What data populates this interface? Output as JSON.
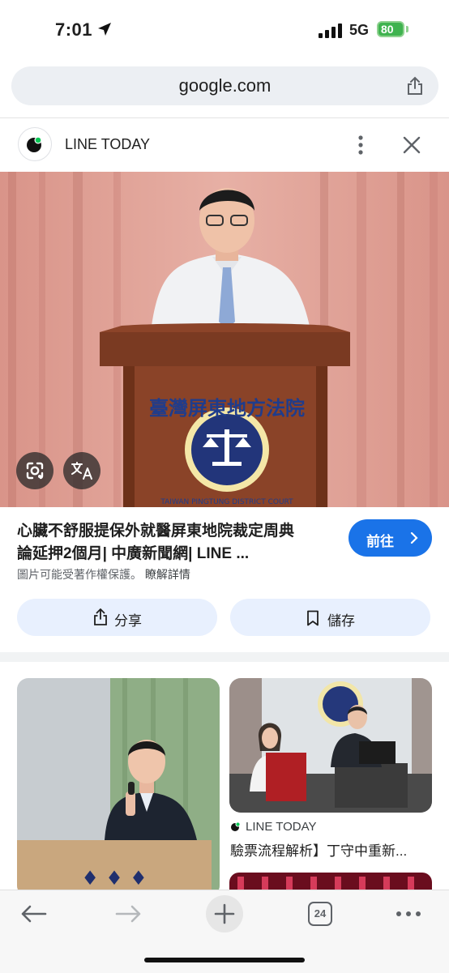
{
  "status_bar": {
    "time": "7:01",
    "network": "5G",
    "battery": "80"
  },
  "browser": {
    "url": "google.com"
  },
  "source": {
    "name": "LINE TODAY"
  },
  "result": {
    "title_line1": "心臟不舒服提保外就醫屏東地院裁定周典",
    "title_line2": "論延押2個月| 中廣新聞網| LINE ...",
    "visit_label": "前往",
    "copyright_text": "圖片可能受著作權保護。",
    "learn_more": "瞭解詳情",
    "share_label": "分享",
    "save_label": "儲存",
    "podium_text": "臺灣屏東地方法院",
    "podium_en": "TAIWAN PINGTUNG DISTRICT COURT"
  },
  "related": [
    {
      "source": "LINE TODAY",
      "title": "驗票流程解析】丁守中重新..."
    }
  ],
  "toolbar": {
    "tab_count": "24"
  },
  "colors": {
    "accent": "#1a73e8",
    "chip": "#e8f0fe",
    "curtain": "#dd9f96",
    "podium": "#7a3a22"
  }
}
